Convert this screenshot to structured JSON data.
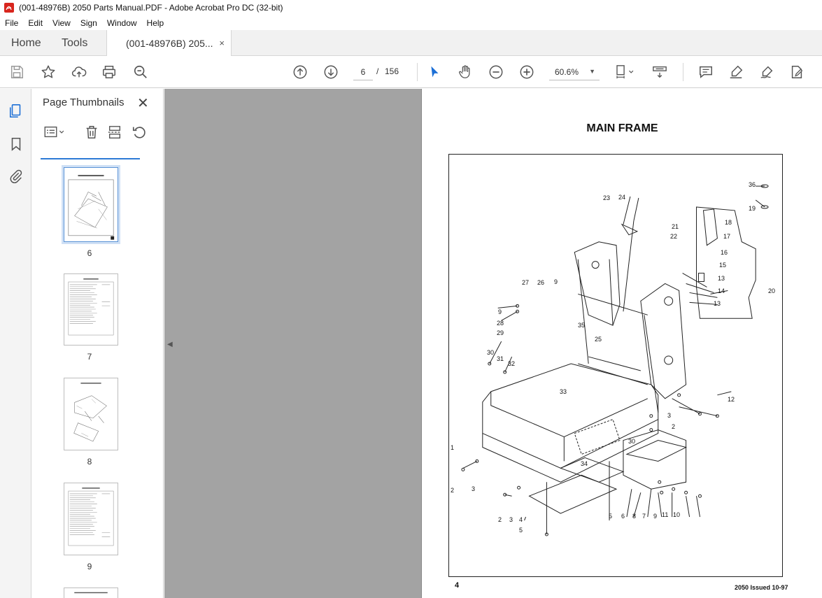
{
  "window": {
    "title": "(001-48976B) 2050 Parts Manual.PDF - Adobe Acrobat Pro DC (32-bit)"
  },
  "menu": [
    "File",
    "Edit",
    "View",
    "Sign",
    "Window",
    "Help"
  ],
  "tabs": {
    "home": "Home",
    "tools": "Tools",
    "document": "(001-48976B) 205...",
    "close": "×"
  },
  "toolbar": {
    "current_page": "6",
    "page_separator": "/",
    "total_pages": "156",
    "zoom": "60.6%",
    "icons": [
      "save-icon",
      "star-icon",
      "cloud-upload-icon",
      "print-icon",
      "find-icon",
      "prev-page-icon",
      "next-page-icon",
      "select-cursor-icon",
      "hand-icon",
      "zoom-out-icon",
      "zoom-in-icon",
      "page-fit-icon",
      "scroll-mode-icon",
      "comment-icon",
      "highlight-icon",
      "sign-icon",
      "edit-pdf-icon"
    ]
  },
  "panel": {
    "title": "Page Thumbnails",
    "close": "✕",
    "thumbnails": [
      {
        "label": "6",
        "selected": true
      },
      {
        "label": "7",
        "selected": false
      },
      {
        "label": "8",
        "selected": false
      },
      {
        "label": "9",
        "selected": false
      }
    ]
  },
  "page": {
    "heading": "MAIN FRAME",
    "page_number": "4",
    "issue": "2050 Issued 10-97",
    "callouts": [
      "36",
      "19",
      "18",
      "17",
      "16",
      "15",
      "13",
      "14",
      "13",
      "20",
      "21",
      "22",
      "23",
      "24",
      "27",
      "26",
      "9",
      "9",
      "28",
      "29",
      "35",
      "25",
      "30",
      "31",
      "32",
      "33",
      "12",
      "3",
      "2",
      "30",
      "1",
      "34",
      "2",
      "3",
      "2",
      "3",
      "4",
      "5",
      "5",
      "6",
      "7",
      "8",
      "9",
      "11",
      "10"
    ]
  }
}
